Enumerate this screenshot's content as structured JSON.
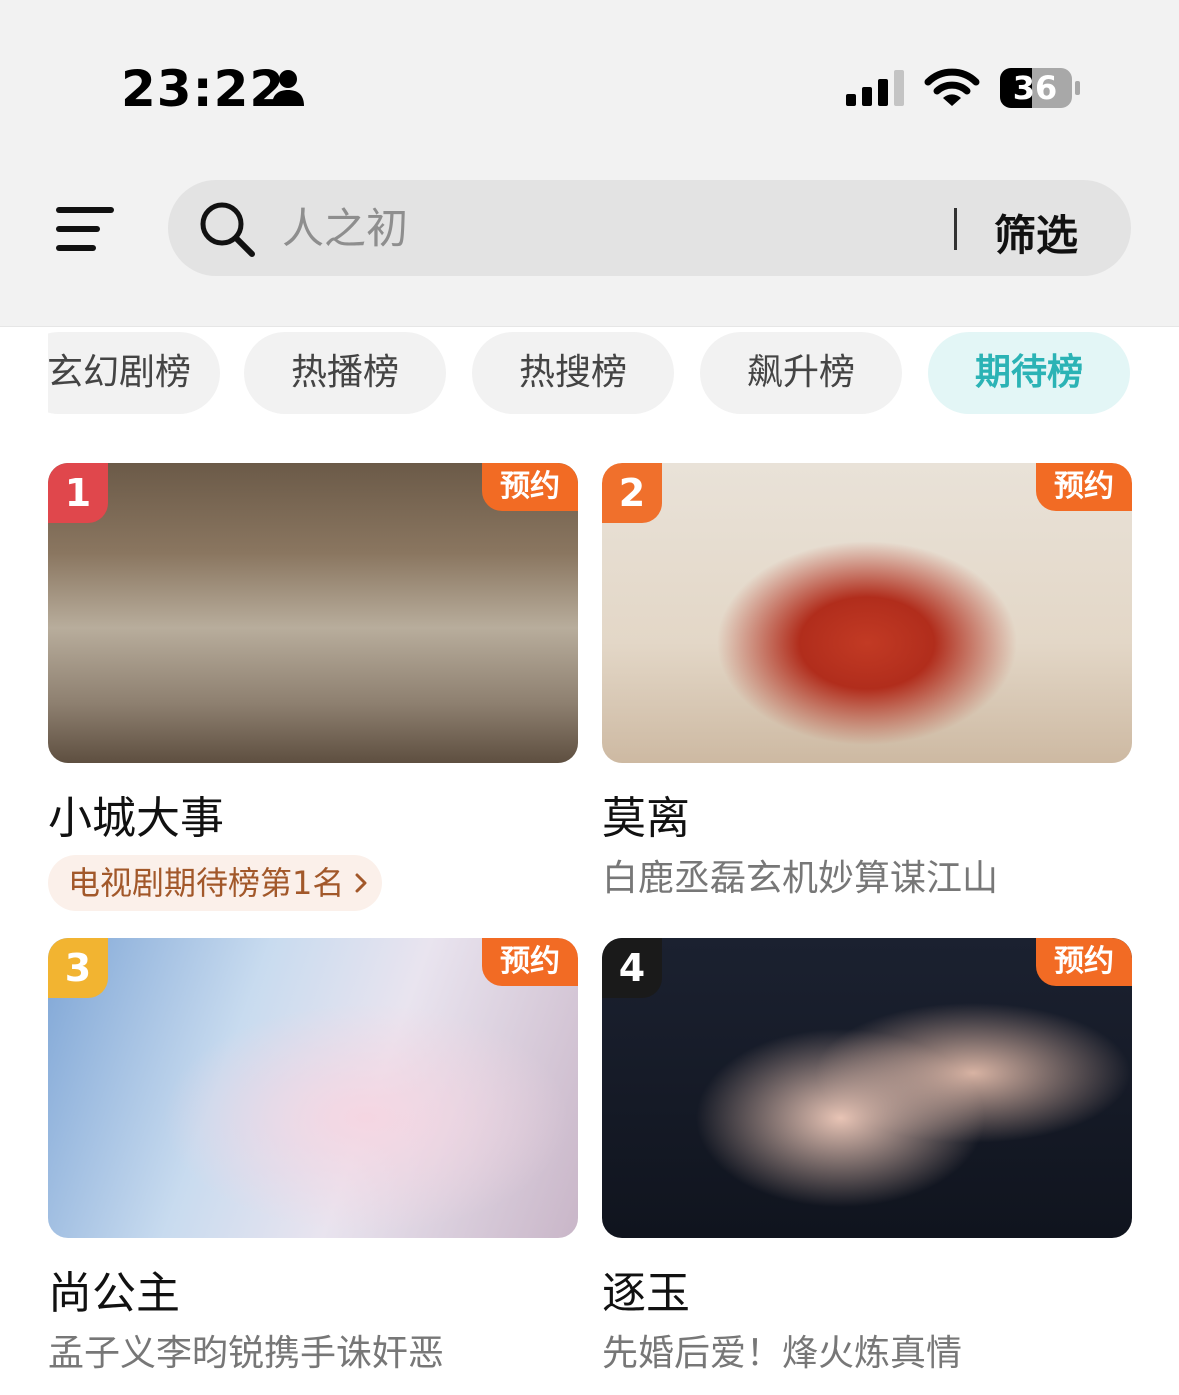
{
  "status_bar": {
    "time": "23:22",
    "battery": "36",
    "icons": [
      "person-icon",
      "signal-icon",
      "wifi-icon",
      "battery-icon"
    ]
  },
  "header": {
    "menu_icon": "menu-icon",
    "search": {
      "placeholder": "人之初",
      "icon": "search-icon"
    },
    "filter_label": "筛选"
  },
  "tabs": [
    {
      "label": "玄幻剧榜",
      "active": false
    },
    {
      "label": "热播榜",
      "active": false
    },
    {
      "label": "热搜榜",
      "active": false
    },
    {
      "label": "飙升榜",
      "active": false
    },
    {
      "label": "期待榜",
      "active": true
    }
  ],
  "accent_color": "#2bb3b5",
  "badge_color": "#f26b24",
  "cards": [
    {
      "rank": "1",
      "rank_color": "#e0474c",
      "badge": "预约",
      "title": "小城大事",
      "subtitle": "",
      "rank_pill": "电视剧期待榜第1名"
    },
    {
      "rank": "2",
      "rank_color": "#f0702c",
      "badge": "预约",
      "title": "莫离",
      "subtitle": "白鹿丞磊玄机妙算谋江山",
      "rank_pill": ""
    },
    {
      "rank": "3",
      "rank_color": "#f2b431",
      "badge": "预约",
      "title": "尚公主",
      "subtitle": "孟子义李昀锐携手诛奸恶",
      "rank_pill": ""
    },
    {
      "rank": "4",
      "rank_color": "#1a1a1a",
      "badge": "预约",
      "title": "逐玉",
      "subtitle": "先婚后爱！烽火炼真情",
      "rank_pill": ""
    }
  ]
}
